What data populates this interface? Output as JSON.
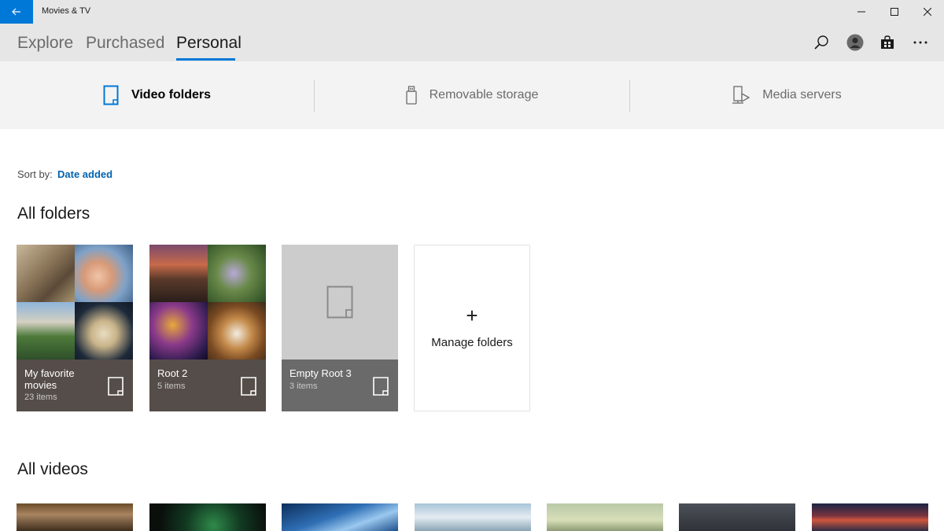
{
  "window": {
    "title": "Movies & TV"
  },
  "header": {
    "tabs": [
      {
        "label": "Explore",
        "active": false
      },
      {
        "label": "Purchased",
        "active": false
      },
      {
        "label": "Personal",
        "active": true
      }
    ],
    "icons": [
      "search-icon",
      "account-icon",
      "store-icon",
      "more-icon"
    ]
  },
  "sources": [
    {
      "label": "Video folders",
      "icon": "video-folder-icon",
      "active": true
    },
    {
      "label": "Removable storage",
      "icon": "usb-drive-icon",
      "active": false
    },
    {
      "label": "Media servers",
      "icon": "media-server-icon",
      "active": false
    }
  ],
  "sort": {
    "label": "Sort by:",
    "value": "Date added"
  },
  "sections": {
    "folders_title": "All folders",
    "videos_title": "All videos"
  },
  "folders": [
    {
      "name": "My favorite movies",
      "count": "23 items"
    },
    {
      "name": "Root 2",
      "count": "5 items"
    },
    {
      "name": "Empty Root 3",
      "count": "3 items"
    }
  ],
  "manage": {
    "plus": "+",
    "label": "Manage folders"
  },
  "colors": {
    "accent": "#0078d7",
    "link": "#0063b1",
    "chrome": "#e6e6e6",
    "source_bar": "#f3f3f3"
  }
}
